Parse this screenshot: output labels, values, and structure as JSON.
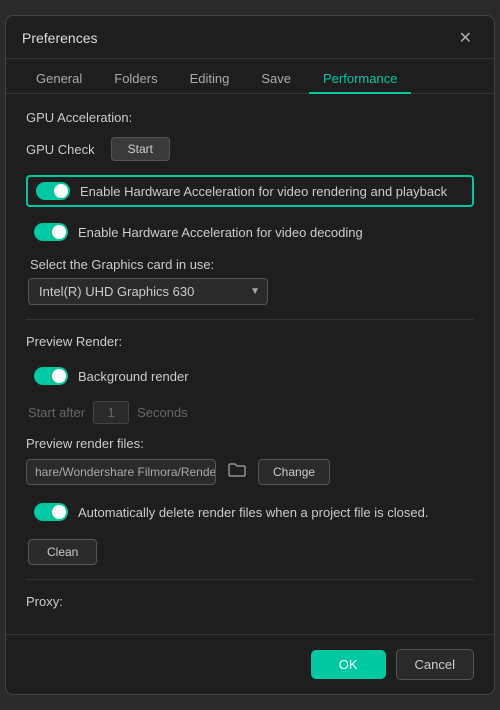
{
  "dialog": {
    "title": "Preferences",
    "close_label": "✕"
  },
  "tabs": {
    "items": [
      {
        "label": "General",
        "active": false
      },
      {
        "label": "Folders",
        "active": false
      },
      {
        "label": "Editing",
        "active": false
      },
      {
        "label": "Save",
        "active": false
      },
      {
        "label": "Performance",
        "active": true
      }
    ]
  },
  "gpu_acceleration": {
    "section_label": "GPU Acceleration:",
    "gpu_check_label": "GPU Check",
    "start_button_label": "Start",
    "toggle1": {
      "label": "Enable Hardware Acceleration for video rendering and playback",
      "checked": true,
      "highlighted": true
    },
    "toggle2": {
      "label": "Enable Hardware Acceleration for video decoding",
      "checked": true,
      "highlighted": false
    },
    "select_label": "Select the Graphics card in use:",
    "graphics_options": [
      "Intel(R) UHD Graphics 630"
    ],
    "graphics_selected": "Intel(R) UHD Graphics 630"
  },
  "preview_render": {
    "section_label": "Preview Render:",
    "background_render_label": "Background render",
    "background_render_checked": true,
    "start_after_label": "Start after",
    "start_after_value": "1",
    "seconds_label": "Seconds",
    "render_files_label": "Preview render files:",
    "render_path_value": "hare/Wondershare Filmora/Render",
    "change_button_label": "Change",
    "auto_delete_label": "Automatically delete render files when a project file is closed.",
    "auto_delete_checked": true,
    "clean_button_label": "Clean"
  },
  "proxy": {
    "section_label": "Proxy:"
  },
  "footer": {
    "ok_label": "OK",
    "cancel_label": "Cancel"
  }
}
